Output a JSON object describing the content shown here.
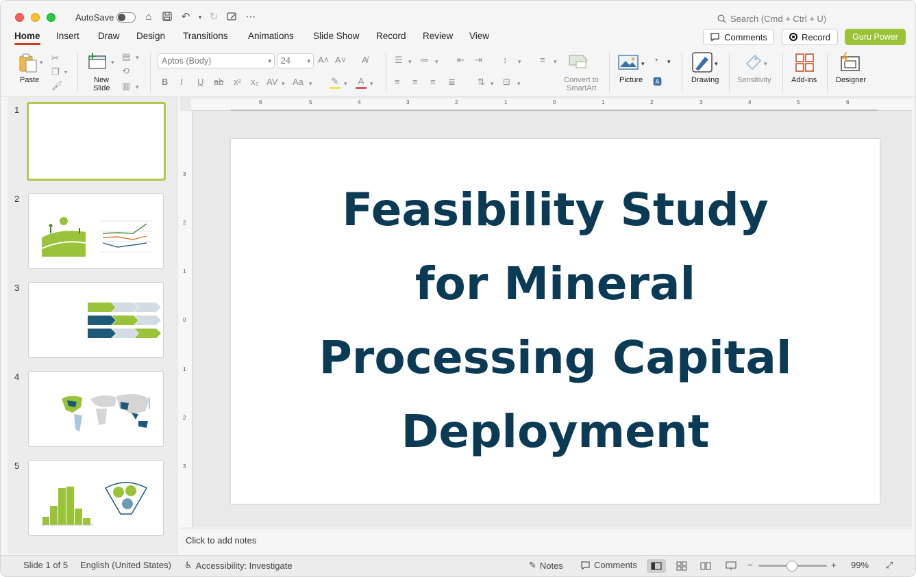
{
  "titlebar": {
    "autosave_label": "AutoSave",
    "search_placeholder": "Search (Cmd + Ctrl + U)"
  },
  "tabs": [
    {
      "label": "Home",
      "active": true
    },
    {
      "label": "Insert"
    },
    {
      "label": "Draw"
    },
    {
      "label": "Design"
    },
    {
      "label": "Transitions"
    },
    {
      "label": "Animations"
    },
    {
      "label": "Slide Show"
    },
    {
      "label": "Record"
    },
    {
      "label": "Review"
    },
    {
      "label": "View"
    }
  ],
  "actions": {
    "comments": "Comments",
    "record": "Record",
    "guru": "Guru Power"
  },
  "ribbon": {
    "paste": "Paste",
    "new_slide_1": "New",
    "new_slide_2": "Slide",
    "font_name": "Aptos (Body)",
    "font_size": "24",
    "smartart_1": "Convert to",
    "smartart_2": "SmartArt",
    "picture": "Picture",
    "drawing": "Drawing",
    "sensitivity": "Sensitivity",
    "addins": "Add-ins",
    "designer": "Designer"
  },
  "thumbnails": [
    {
      "num": "1",
      "selected": true
    },
    {
      "num": "2"
    },
    {
      "num": "3"
    },
    {
      "num": "4"
    },
    {
      "num": "5"
    }
  ],
  "ruler": {
    "h": [
      "6",
      "5",
      "4",
      "3",
      "2",
      "1",
      "0",
      "1",
      "2",
      "3",
      "4",
      "5",
      "6"
    ],
    "v": [
      "3",
      "2",
      "1",
      "0",
      "1",
      "2",
      "3"
    ]
  },
  "slide": {
    "title_lines": [
      "Feasibility Study",
      "for Mineral",
      "Processing Capital",
      "Deployment"
    ]
  },
  "notes_placeholder": "Click to add notes",
  "status": {
    "slide_info": "Slide 1 of 5",
    "language": "English (United States)",
    "accessibility": "Accessibility: Investigate",
    "notes": "Notes",
    "comments": "Comments",
    "zoom": "99%"
  },
  "colors": {
    "accent": "#9bc33a",
    "title_text": "#0b3a54",
    "active_tab_underline": "#c43e1c"
  }
}
